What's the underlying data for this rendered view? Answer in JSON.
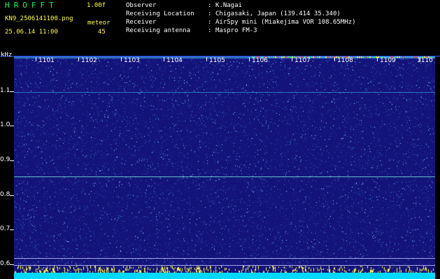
{
  "header": {
    "app_title": "HROFFT",
    "version": "1.00f",
    "file_name": "KN9_2506141100.png",
    "timestamp": "25.06.14 11:00",
    "meteor_label": "meteor",
    "meteor_count": "45"
  },
  "info": [
    {
      "label": "Observer",
      "value": "K.Nagai"
    },
    {
      "label": "Receiving Location",
      "value": "Chigasaki, Japan (139.414 35.340)"
    },
    {
      "label": "Receiver",
      "value": "AirSpy mini (Miakejima VOR 108.65MHz)"
    },
    {
      "label": "Receiving antenna",
      "value": "Maspro FM-3"
    }
  ],
  "axis": {
    "unit": "kHz",
    "y_ticks": [
      "1.1",
      "1.0",
      "0.9",
      "0.8",
      "0.7",
      "0.6"
    ],
    "x_ticks": [
      "1101",
      "1102",
      "1103",
      "1104",
      "1105",
      "1106",
      "1107",
      "1108",
      "1109",
      "1110"
    ]
  },
  "colors": {
    "background": "#13137a",
    "signal_cyan": "#00d8ff",
    "signal_yellow": "#ffff40"
  }
}
